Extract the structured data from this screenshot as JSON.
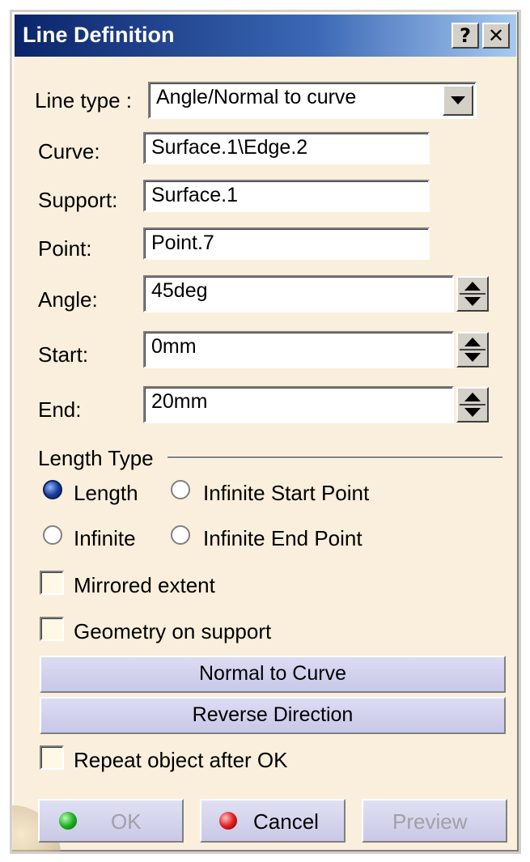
{
  "window": {
    "title": "Line Definition",
    "help_label": "?",
    "close_label": "✕"
  },
  "line_type": {
    "label": "Line type :",
    "value": "Angle/Normal to curve"
  },
  "fields": {
    "curve": {
      "label": "Curve:",
      "value": "Surface.1\\Edge.2"
    },
    "support": {
      "label": "Support:",
      "value": "Surface.1"
    },
    "point": {
      "label": "Point:",
      "value": "Point.7"
    },
    "angle": {
      "label": "Angle:",
      "value": "45deg"
    },
    "start": {
      "label": "Start:",
      "value": "0mm"
    },
    "end": {
      "label": "End:",
      "value": "20mm"
    }
  },
  "length_type": {
    "group_label": "Length Type",
    "options": [
      {
        "label": "Length",
        "selected": true
      },
      {
        "label": "Infinite Start Point",
        "selected": false
      },
      {
        "label": "Infinite",
        "selected": false
      },
      {
        "label": "Infinite End Point",
        "selected": false
      }
    ]
  },
  "checks": {
    "mirrored": {
      "label": "Mirrored extent",
      "checked": false
    },
    "geometry": {
      "label": "Geometry on support",
      "checked": false
    },
    "repeat": {
      "label": "Repeat object after OK",
      "checked": false
    }
  },
  "buttons": {
    "normal_to_curve": "Normal to Curve",
    "reverse_direction": "Reverse Direction",
    "ok": "OK",
    "cancel": "Cancel",
    "preview": "Preview"
  },
  "colors": {
    "title_bar": "#0a246a",
    "dialog_bg": "#f9efdc",
    "button_bg": "#c9c9e6"
  }
}
